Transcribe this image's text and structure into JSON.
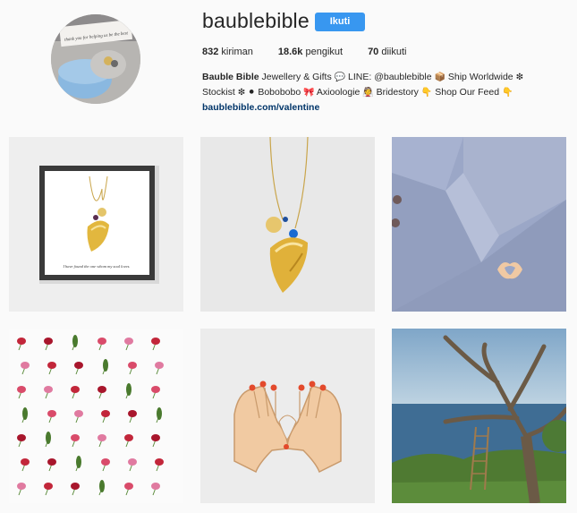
{
  "profile": {
    "username": "baublebible",
    "follow_label": "Ikuti",
    "follow_color": "#3897f0",
    "avatar_text": "thank you for helping us be the best"
  },
  "stats": {
    "posts_count": "832",
    "posts_label": "kiriman",
    "followers_count": "18.6k",
    "followers_label": "pengikut",
    "following_count": "70",
    "following_label": "diikuti"
  },
  "bio": {
    "name": "Bauble Bible",
    "line1_a": "Jewellery & Gifts",
    "line1_b": "LINE: @baublebible",
    "line1_c": "Ship Worldwide",
    "line2_a": "Stockist",
    "line2_b": "Bobobobo",
    "line2_c": "Axioologie",
    "line2_d": "Bridestory",
    "line2_e": "Shop Our Feed",
    "link": "baublebible.com/valentine"
  },
  "posts": [
    {
      "image": "framed-necklace",
      "caption": "I have found the one whom my soul loves."
    },
    {
      "image": "necklace-pendant"
    },
    {
      "image": "shirt-collar-pin"
    },
    {
      "image": "flower-grid"
    },
    {
      "image": "heart-hands-pin"
    },
    {
      "image": "tree-ladder-sea"
    }
  ]
}
